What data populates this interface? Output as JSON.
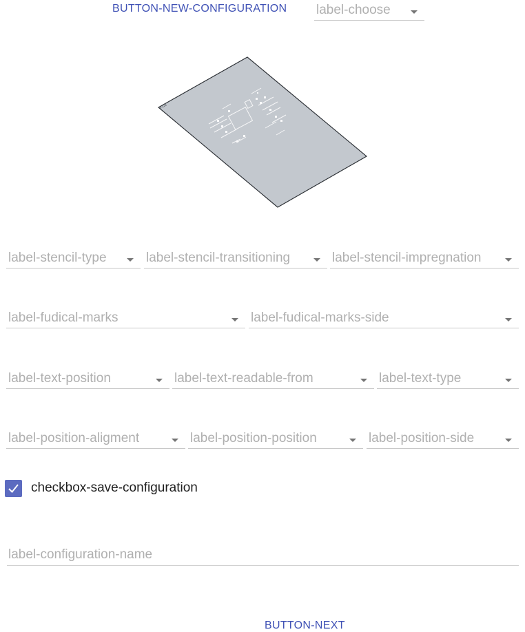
{
  "header": {
    "new_config_button": "BUTTON-NEW-CONFIGURATION",
    "choose_select": "label-choose"
  },
  "preview": {
    "board_mark": "F.Cu"
  },
  "row1": {
    "stencil_type": "label-stencil-type",
    "stencil_transitioning": "label-stencil-transitioning",
    "stencil_impregnation": "label-stencil-impregnation"
  },
  "row2": {
    "fudical_marks": "label-fudical-marks",
    "fudical_marks_side": "label-fudical-marks-side"
  },
  "row3": {
    "text_position": "label-text-position",
    "text_readable_from": "label-text-readable-from",
    "text_type": "label-text-type"
  },
  "row4": {
    "position_aligment": "label-position-aligment",
    "position_position": "label-position-position",
    "position_side": "label-position-side"
  },
  "save": {
    "checkbox_label": "checkbox-save-configuration",
    "checked": true,
    "accent": "#5c6bc0"
  },
  "config_name": {
    "placeholder": "label-configuration-name"
  },
  "footer": {
    "next_button": "BUTTON-NEXT"
  },
  "colors": {
    "primary": "#3f51b5",
    "stencil_fill": "#c3c8ce"
  },
  "icons": {
    "dropdown": "caret-down-icon",
    "check": "checkmark-icon"
  }
}
